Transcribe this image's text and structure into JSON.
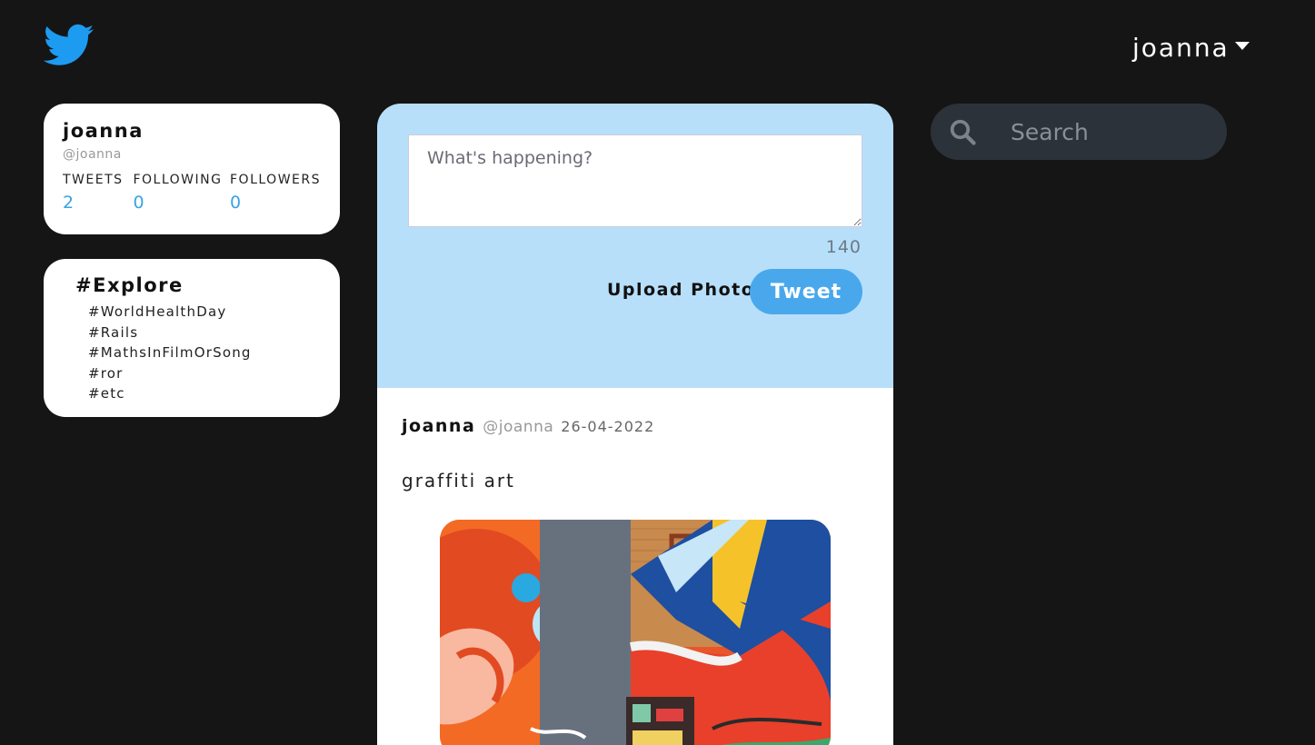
{
  "header": {
    "logo_icon": "twitter-bird-icon",
    "user_menu_label": "joanna"
  },
  "profile": {
    "name": "joanna",
    "handle": "@joanna",
    "stats": [
      {
        "label": "TWEETS",
        "value": "2"
      },
      {
        "label": "FOLLOWING",
        "value": "0"
      },
      {
        "label": "FOLLOWERS",
        "value": "0"
      }
    ]
  },
  "explore": {
    "title": "#Explore",
    "tags": [
      "#WorldHealthDay",
      "#Rails",
      "#MathsInFilmOrSong",
      "#ror",
      "#etc"
    ]
  },
  "compose": {
    "placeholder": "What's happening?",
    "char_count": "140",
    "upload_label": "Upload Photo",
    "tweet_label": "Tweet"
  },
  "tweet": {
    "author": "joanna",
    "handle": "@joanna",
    "date": "26-04-2022",
    "text": "graffiti art"
  },
  "search": {
    "placeholder": "Search"
  },
  "colors": {
    "background": "#151516",
    "accent": "#1d9bf0",
    "compose_bg": "#b7dffa",
    "tweet_button": "#49a8ec",
    "stat_value": "#3aa3e3"
  }
}
